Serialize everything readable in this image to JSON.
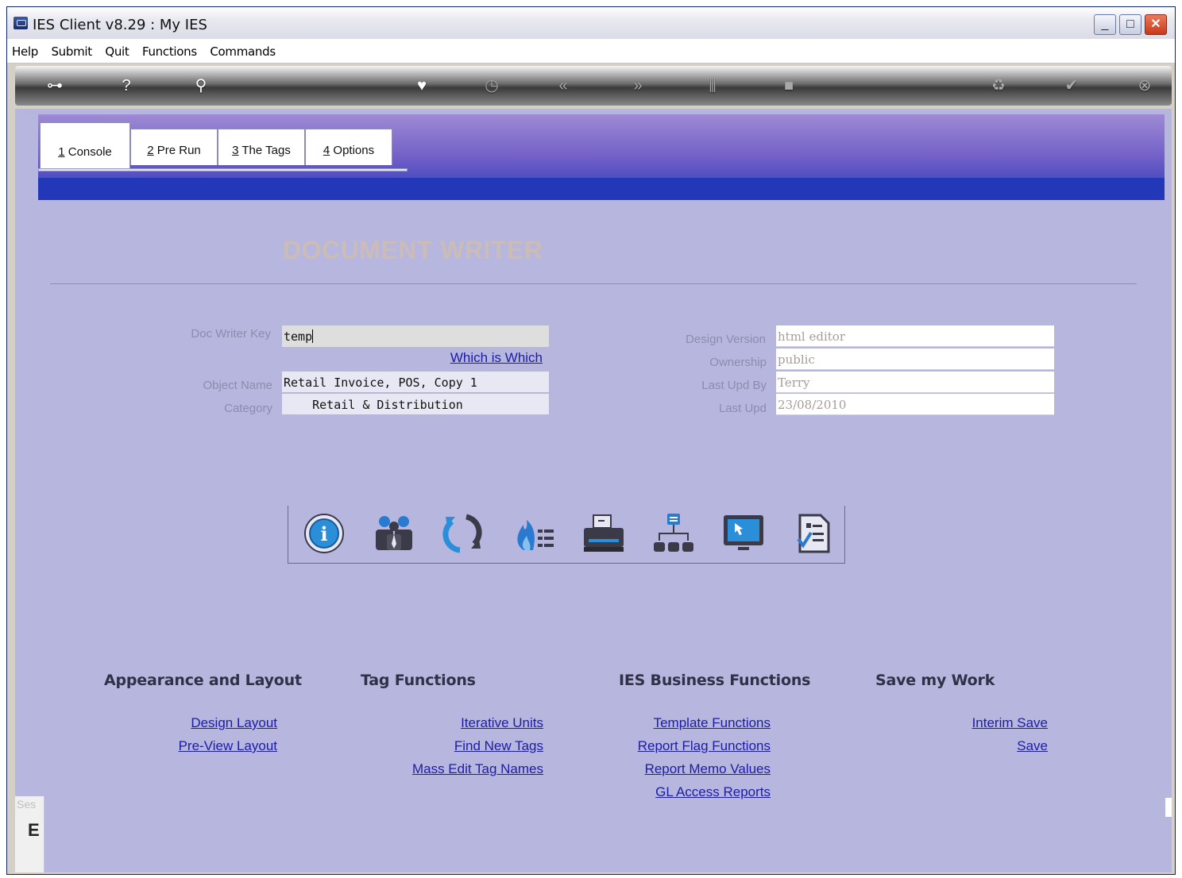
{
  "window": {
    "title": "IES Client v8.29 : My IES"
  },
  "menu": [
    "Help",
    "Submit",
    "Quit",
    "Functions",
    "Commands"
  ],
  "toolbar_icons": [
    "key-icon",
    "help-icon",
    "search-icon",
    "heart-icon",
    "clock-icon",
    "rewind-icon",
    "forward-icon",
    "chart-icon",
    "square-icon",
    "recycle-icon",
    "check-icon",
    "close-icon"
  ],
  "tabs": [
    {
      "key": "1",
      "label": " Console"
    },
    {
      "key": "2",
      "label": " Pre Run"
    },
    {
      "key": "3",
      "label": " The Tags"
    },
    {
      "key": "4",
      "label": " Options"
    }
  ],
  "page": {
    "title": "DOCUMENT WRITER"
  },
  "form": {
    "doc_writer_key_label": "Doc Writer Key",
    "doc_writer_key_value": "temp",
    "which_is_which": "Which is Which",
    "object_name_label": "Object Name",
    "object_name_value": "Retail Invoice, POS, Copy 1",
    "category_label": "Category",
    "category_value": "    Retail & Distribution",
    "design_version_label": "Design Version",
    "design_version_value": "html editor",
    "ownership_label": "Ownership",
    "ownership_value": "public",
    "last_upd_by_label": "Last Upd By",
    "last_upd_by_value": "Terry",
    "last_upd_label": "Last Upd",
    "last_upd_value": "23/08/2010"
  },
  "action_icons": [
    "info-icon",
    "users-icon",
    "refresh-icon",
    "fire-list-icon",
    "printer-icon",
    "hierarchy-icon",
    "monitor-icon",
    "checklist-doc-icon"
  ],
  "sections": {
    "appearance": {
      "heading": "Appearance and Layout",
      "links": [
        "Design Layout",
        "Pre-View Layout"
      ]
    },
    "tag_functions": {
      "heading": "Tag Functions",
      "links": [
        "Iterative Units",
        "Find New Tags",
        "Mass Edit Tag Names"
      ]
    },
    "business": {
      "heading": "IES Business Functions",
      "links": [
        "Template Functions",
        "Report Flag Functions",
        "Report Memo Values",
        "GL Access Reports"
      ]
    },
    "save": {
      "heading": "Save my Work",
      "links": [
        "Interim Save",
        "Save"
      ]
    }
  },
  "status": {
    "label": "Ses",
    "glyph": "E"
  },
  "colors": {
    "content_bg": "#b6b6df",
    "link": "#1c1ca8",
    "header_top": "#9e8ad4",
    "header_bottom": "#2338b8"
  }
}
